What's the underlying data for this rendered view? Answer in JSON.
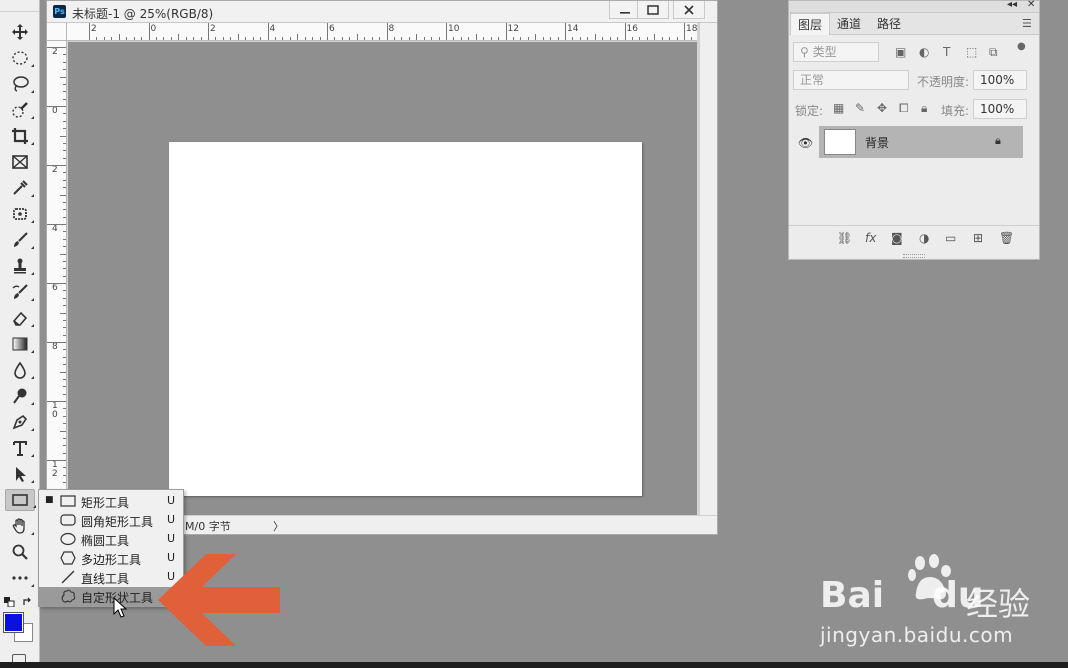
{
  "document": {
    "title": "未标题-1 @ 25%(RGB/8)",
    "app_icon": "Ps",
    "status_text": "M/0 字节",
    "status_arrow": "〉",
    "ruler_top_labels": [
      "2",
      "0",
      "2",
      "4",
      "6",
      "8",
      "10",
      "12",
      "14",
      "16",
      "18"
    ],
    "ruler_left_labels": [
      "2",
      "0",
      "2",
      "4",
      "6",
      "8",
      "1\n0",
      "1\n2"
    ],
    "window_buttons": [
      "minimize",
      "maximize",
      "close"
    ]
  },
  "toolbar": {
    "tools": [
      "move-tool-icon",
      "marquee-tool-icon",
      "lasso-tool-icon",
      "quick-select-tool-icon",
      "crop-tool-icon",
      "frame-tool-icon",
      "eyedropper-tool-icon",
      "patch-tool-icon",
      "brush-tool-icon",
      "stamp-tool-icon",
      "history-brush-icon",
      "eraser-tool-icon",
      "gradient-tool-icon",
      "blur-tool-icon",
      "dodge-tool-icon",
      "pen-tool-icon",
      "type-tool-icon",
      "path-select-tool-icon",
      "rectangle-tool-icon",
      "hand-tool-icon",
      "zoom-tool-icon",
      "more-tools-icon"
    ],
    "foreground_color": "#0a10e0",
    "background_color": "#ffffff"
  },
  "flyout": {
    "items": [
      {
        "label": "矩形工具",
        "key": "U",
        "icon": "rectangle-shape-icon",
        "selected": true
      },
      {
        "label": "圆角矩形工具",
        "key": "U",
        "icon": "rounded-rectangle-icon",
        "selected": false
      },
      {
        "label": "椭圆工具",
        "key": "U",
        "icon": "ellipse-icon",
        "selected": false
      },
      {
        "label": "多边形工具",
        "key": "U",
        "icon": "polygon-icon",
        "selected": false
      },
      {
        "label": "直线工具",
        "key": "U",
        "icon": "line-icon",
        "selected": false
      },
      {
        "label": "自定形状工具",
        "key": "U",
        "icon": "custom-shape-icon",
        "selected": false,
        "hover": true
      }
    ]
  },
  "layers_panel": {
    "tabs": [
      "图层",
      "通道",
      "路径"
    ],
    "active_tab": "图层",
    "filter_placeholder": "类型",
    "blend_mode": "正常",
    "opacity_label": "不透明度:",
    "opacity_value": "100%",
    "lock_label": "锁定:",
    "fill_label": "填充:",
    "fill_value": "100%",
    "collapse_glyph": "◂◂",
    "close_glyph": "✕",
    "menu_glyph": "☰",
    "layers": [
      {
        "name": "背景",
        "visible": true,
        "locked": true
      }
    ],
    "footer_icons": [
      "link-icon",
      "fx-icon",
      "mask-icon",
      "adjustment-icon",
      "folder-icon",
      "new-layer-icon",
      "trash-icon"
    ],
    "footer_fx": "fx"
  },
  "watermark": {
    "brand": "Bai",
    "brand_suffix": "du",
    "cn": "经验",
    "url": "jingyan.baidu.com"
  },
  "annotation_arrow_color": "#e0603a"
}
